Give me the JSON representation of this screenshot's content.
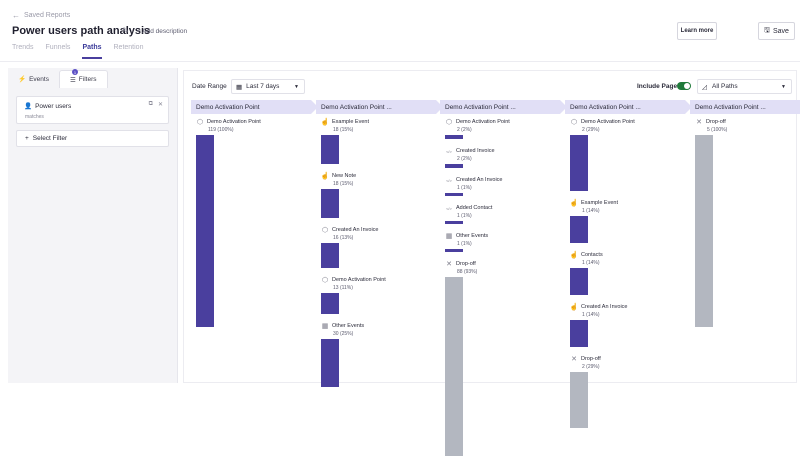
{
  "header": {
    "back_label": "Saved Reports",
    "title": "Power users path analysis",
    "add_description": "Add description",
    "tabs": [
      {
        "label": "Trends"
      },
      {
        "label": "Funnels"
      },
      {
        "label": "Paths",
        "active": true
      },
      {
        "label": "Retention"
      }
    ],
    "learn_more": "Learn more",
    "save": "Save"
  },
  "sidebar": {
    "tabs": [
      {
        "label": "Events"
      },
      {
        "label": "Filters"
      }
    ],
    "filters_badge": "1",
    "filter": {
      "name": "Power users",
      "sub": "matches"
    },
    "select_filter": "Select Filter"
  },
  "controls": {
    "date_range_label": "Date Range",
    "date_range_value": "Last 7 days",
    "include_pages_label": "Include Pages",
    "include_pages_on": true,
    "paths_value": "All Paths"
  },
  "colors": {
    "accent": "#4a3f9e",
    "header": "#e1dff6",
    "dropoff": "#b3b7c0",
    "toggle": "#1f7a3a"
  },
  "columns": [
    {
      "header": "Demo Activation Point",
      "nodes": [
        {
          "icon": "cube-icon",
          "label": "Demo Activation Point",
          "count": "119 (100%)",
          "share": 1.0
        }
      ]
    },
    {
      "header": "Demo Activation Point ...",
      "nodes": [
        {
          "icon": "cursor-icon",
          "label": "Example Event",
          "count": "18 (15%)",
          "share": 0.15
        },
        {
          "icon": "cursor-icon",
          "label": "New Note",
          "count": "18 (15%)",
          "share": 0.15
        },
        {
          "icon": "cube-icon",
          "label": "Created An Invoice",
          "count": "16 (13%)",
          "share": 0.13
        },
        {
          "icon": "cube-icon",
          "label": "Demo Activation Point",
          "count": "13 (11%)",
          "share": 0.11
        },
        {
          "icon": "grid-icon",
          "label": "Other Events",
          "count": "30 (25%)",
          "share": 0.25
        }
      ]
    },
    {
      "header": "Demo Activation Point ...",
      "nodes": [
        {
          "icon": "cube-icon",
          "label": "Demo Activation Point",
          "count": "2 (2%)",
          "share": 0.02
        },
        {
          "icon": "code-icon",
          "label": "Created Invoice",
          "count": "2 (2%)",
          "share": 0.02
        },
        {
          "icon": "code-icon",
          "label": "Created An Invoice",
          "count": "1 (1%)",
          "share": 0.01
        },
        {
          "icon": "code-icon",
          "label": "Added Contact",
          "count": "1 (1%)",
          "share": 0.01
        },
        {
          "icon": "grid-icon",
          "label": "Other Events",
          "count": "1 (1%)",
          "share": 0.01
        },
        {
          "icon": "cross-icon",
          "label": "Drop-off",
          "count": "88 (93%)",
          "share": 0.93,
          "drop": true
        }
      ]
    },
    {
      "header": "Demo Activation Point ...",
      "nodes": [
        {
          "icon": "cube-icon",
          "label": "Demo Activation Point",
          "count": "2 (29%)",
          "share": 0.29
        },
        {
          "icon": "cursor-icon",
          "label": "Example Event",
          "count": "1 (14%)",
          "share": 0.14
        },
        {
          "icon": "cursor-icon",
          "label": "Contacts",
          "count": "1 (14%)",
          "share": 0.14
        },
        {
          "icon": "cursor-icon",
          "label": "Created An Invoice",
          "count": "1 (14%)",
          "share": 0.14
        },
        {
          "icon": "cross-icon",
          "label": "Drop-off",
          "count": "2 (29%)",
          "share": 0.29,
          "drop": true
        }
      ]
    },
    {
      "header": "Demo Activation Point ...",
      "nodes": [
        {
          "icon": "cross-icon",
          "label": "Drop-off",
          "count": "5 (100%)",
          "share": 1.0,
          "drop": true
        }
      ]
    }
  ]
}
